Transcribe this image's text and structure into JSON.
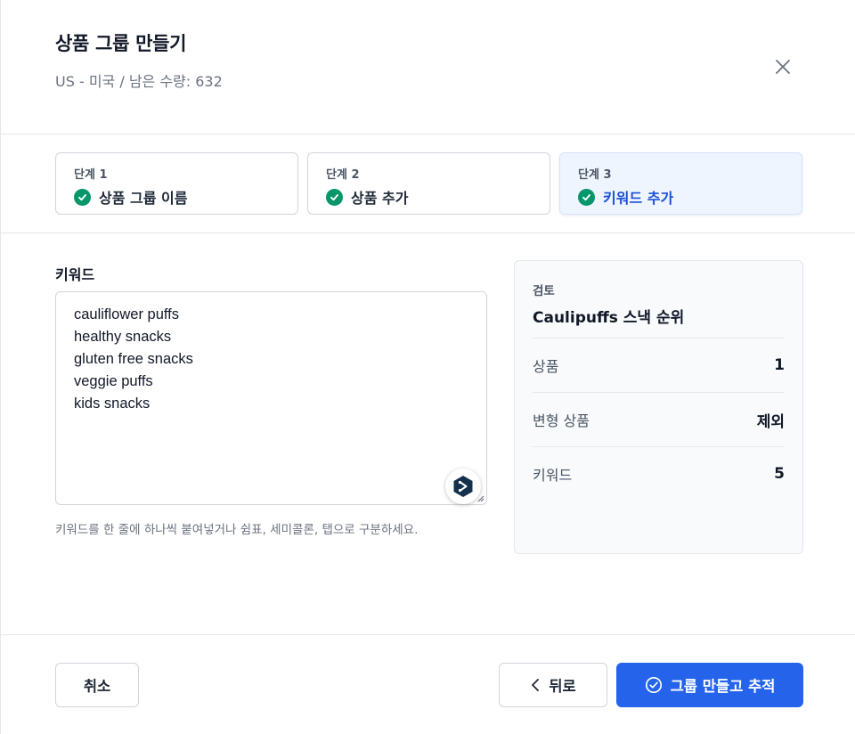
{
  "header": {
    "title": "상품 그룹 만들기",
    "subtitle": "US - 미국 / 남은 수량: 632"
  },
  "steps": [
    {
      "number": "단계 1",
      "label": "상품 그룹 이름",
      "status": "complete"
    },
    {
      "number": "단계 2",
      "label": "상품 추가",
      "status": "complete"
    },
    {
      "number": "단계 3",
      "label": "키워드 추가",
      "status": "active"
    }
  ],
  "keywords": {
    "label": "키워드",
    "lines": [
      "cauliflower puffs",
      "healthy snacks",
      "gluten free snacks",
      "veggie puffs",
      "kids snacks"
    ],
    "hint": "키워드를 한 줄에 하나씩 붙여넣거나 쉼표, 세미콜론, 탭으로 구분하세요."
  },
  "review": {
    "eyebrow": "검토",
    "name": "Caulipuffs 스낵 순위",
    "rows": [
      {
        "label": "상품",
        "value": "1"
      },
      {
        "label": "변형 상품",
        "value": "제외"
      },
      {
        "label": "키워드",
        "value": "5"
      }
    ]
  },
  "footer": {
    "cancel_label": "취소",
    "back_label": "뒤로",
    "create_label": "그룹 만들고 추적"
  },
  "colors": {
    "primary": "#2563eb",
    "success": "#059669",
    "active_step_bg": "#eef5ff"
  }
}
